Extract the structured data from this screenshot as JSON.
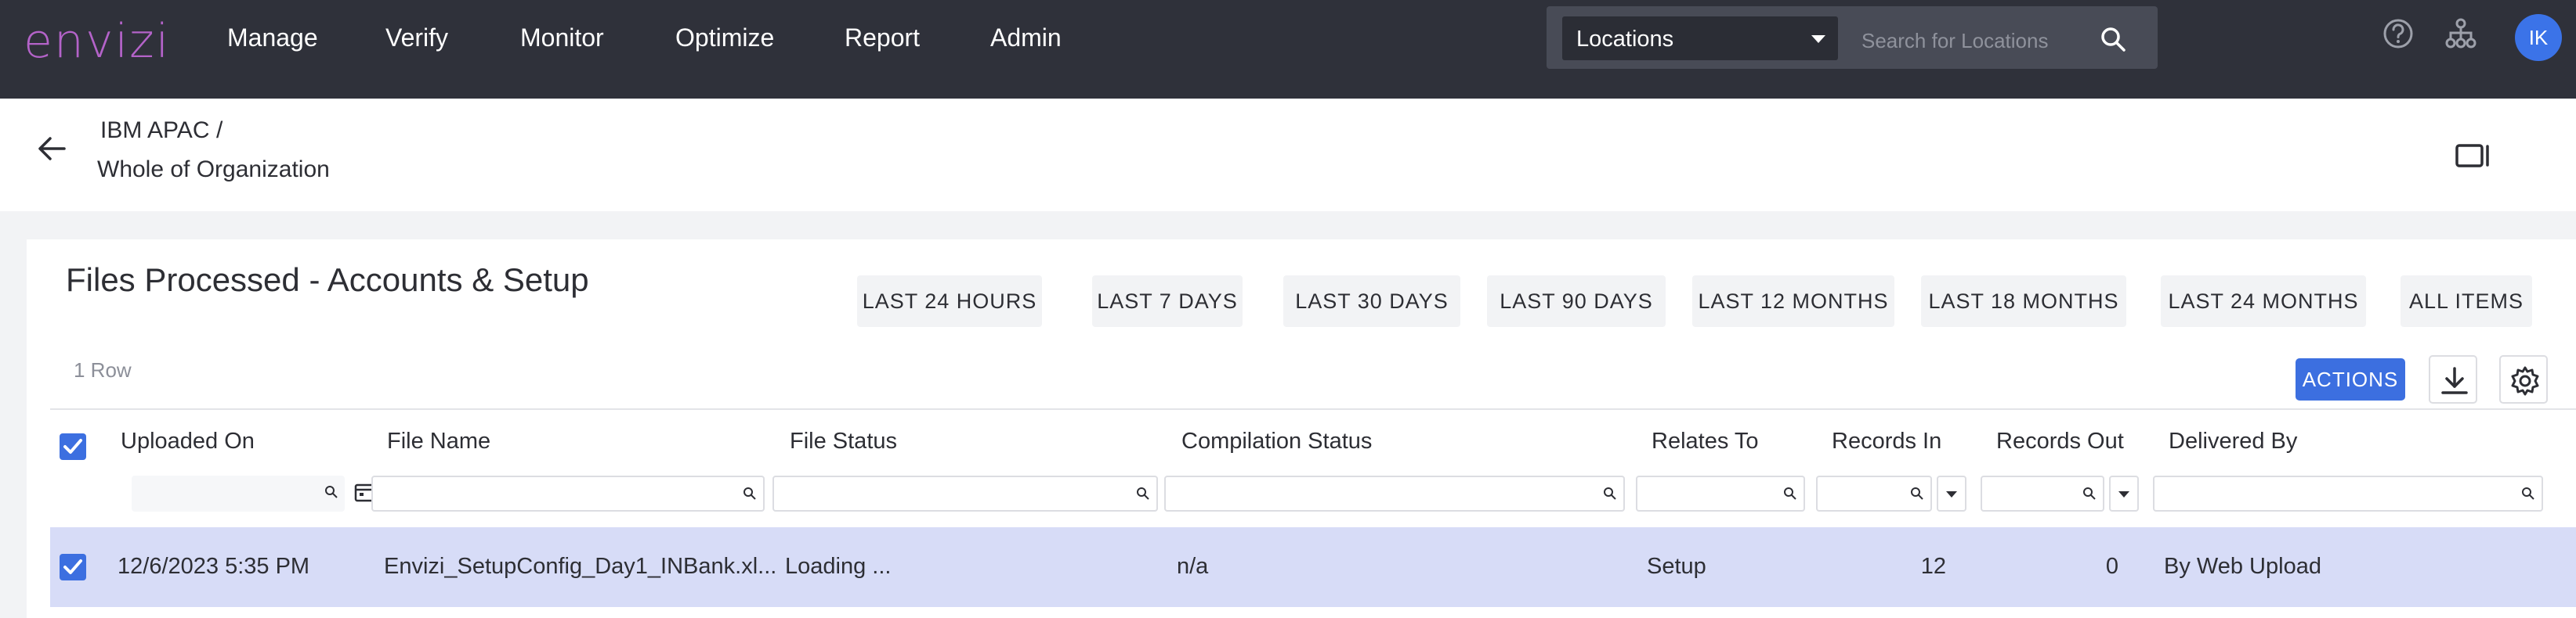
{
  "app": {
    "logo": "envizi"
  },
  "nav": {
    "items": [
      "Manage",
      "Verify",
      "Monitor",
      "Optimize",
      "Report",
      "Admin"
    ]
  },
  "search": {
    "scope_selected": "Locations",
    "placeholder": "Search for Locations"
  },
  "user": {
    "initials": "IK"
  },
  "breadcrumb": {
    "parent": "IBM APAC",
    "separator": "/",
    "current": "Whole of Organization"
  },
  "report": {
    "title": "Files Processed - Accounts & Setup",
    "periods": [
      "LAST 24 HOURS",
      "LAST 7 DAYS",
      "LAST 30 DAYS",
      "LAST 90 DAYS",
      "LAST 12 MONTHS",
      "LAST 18 MONTHS",
      "LAST 24 MONTHS",
      "ALL ITEMS"
    ],
    "row_count": "1 Row",
    "actions_label": "ACTIONS"
  },
  "table": {
    "columns": [
      "Uploaded On",
      "File Name",
      "File Status",
      "Compilation Status",
      "Relates To",
      "Records In",
      "Records Out",
      "Delivered By"
    ],
    "rows": [
      {
        "uploaded_on": "12/6/2023 5:35 PM",
        "file_name": "Envizi_SetupConfig_Day1_INBank.xl...",
        "file_status": "Loading ...",
        "compilation_status": "n/a",
        "relates_to": "Setup",
        "records_in": "12",
        "records_out": "0",
        "delivered_by": "By Web Upload"
      }
    ]
  },
  "colors": {
    "nav_bg": "#2f313a",
    "accent": "#3c6fe0",
    "logo": "#b463c9",
    "selected_row": "#d7dcf7"
  },
  "icons": [
    "help-icon",
    "hierarchy-icon",
    "search-icon",
    "back-arrow-icon",
    "panel-icon",
    "download-icon",
    "settings-icon",
    "calendar-icon",
    "checkbox-checked-icon"
  ]
}
